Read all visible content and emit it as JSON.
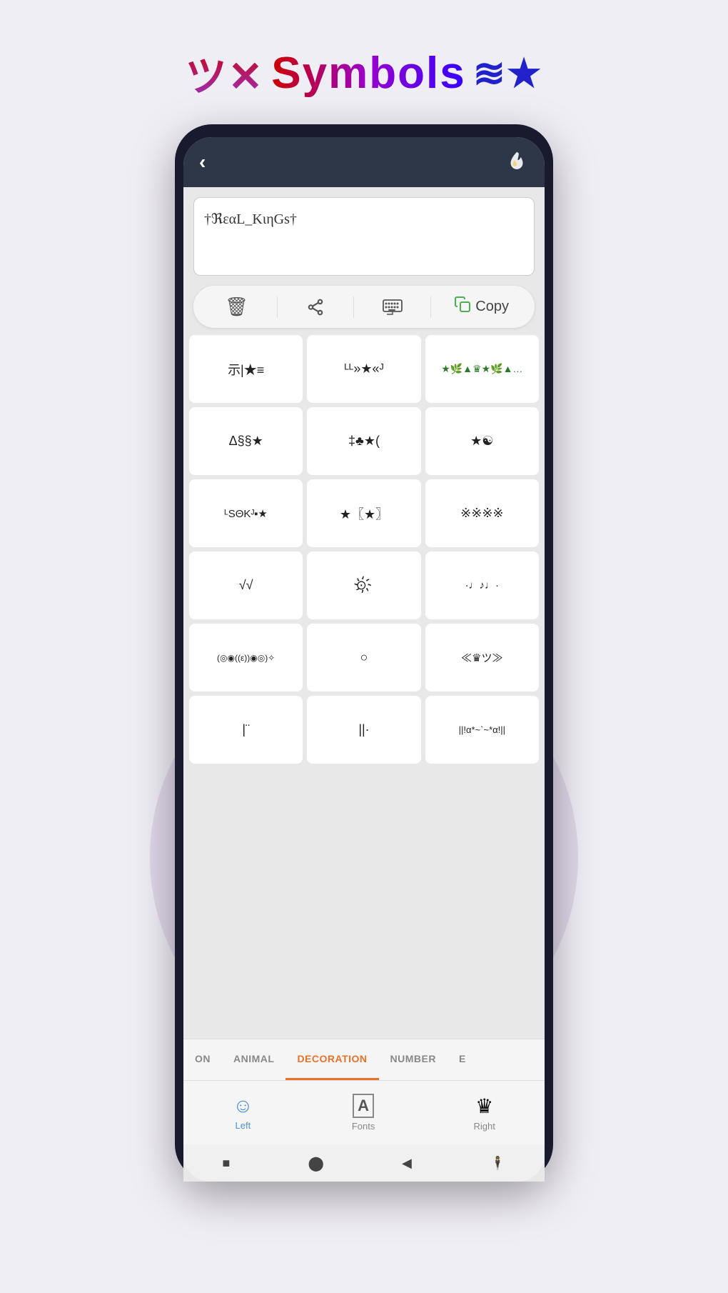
{
  "app": {
    "title_katakana": "ツ✕",
    "title_text": "Symbols",
    "title_right": "≋★"
  },
  "phone": {
    "header": {
      "back_label": "‹",
      "flame_label": "🔥"
    },
    "text_input": {
      "value": "†ℜεαL_KιηGs†"
    },
    "actions": {
      "delete_label": "🗑",
      "share_label": "⎋",
      "keyboard_label": "⌨",
      "copy_icon": "⧉",
      "copy_label": "Copy"
    },
    "grid": {
      "rows": [
        [
          "示|★≡",
          "ᴸᴸ»★«ᴶ",
          "★🎭▲♛★🎭▲..."
        ],
        [
          "Δ§§★",
          "‡♣★(",
          "★☯"
        ],
        [
          "ᴸSΘKᴶ■★",
          "★〖★〗",
          "※※※※"
        ],
        [
          "√√",
          "⊙҉",
          ".·♩♪♩·."
        ],
        [
          "(◎◉((ε))◉◎)✧",
          "○",
          "≪♛ツ≫"
        ],
        [
          "|\"`",
          "||·",
          "||!α*~`~*α!||"
        ]
      ]
    },
    "categories": {
      "items": [
        "ON",
        "ANIMAL",
        "DECORATION",
        "NUMBER",
        "E"
      ],
      "active": "DECORATION"
    },
    "bottom_nav": {
      "items": [
        {
          "label": "Left",
          "icon": "☺",
          "active": true
        },
        {
          "label": "Fonts",
          "icon": "A",
          "active": false
        },
        {
          "label": "Right",
          "icon": "♛",
          "active": false
        }
      ]
    },
    "system_nav": {
      "square": "■",
      "circle": "⬤",
      "triangle": "◀",
      "person": "♟"
    }
  }
}
